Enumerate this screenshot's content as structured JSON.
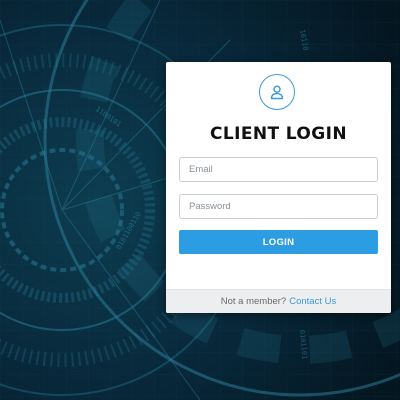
{
  "background": {
    "description_colors": [
      "#061e2a",
      "#0a3344",
      "#175a73"
    ]
  },
  "login_card": {
    "avatar_icon": "user-icon",
    "title": "CLIENT LOGIN",
    "email": {
      "value": "",
      "placeholder": "Email"
    },
    "password": {
      "value": "",
      "placeholder": "Password"
    },
    "login_button_label": "LOGIN",
    "footer": {
      "prompt": "Not a member?",
      "link_label": "Contact Us"
    }
  },
  "colors": {
    "accent": "#2d9de3",
    "link": "#3a9ad9",
    "title": "#111111"
  }
}
